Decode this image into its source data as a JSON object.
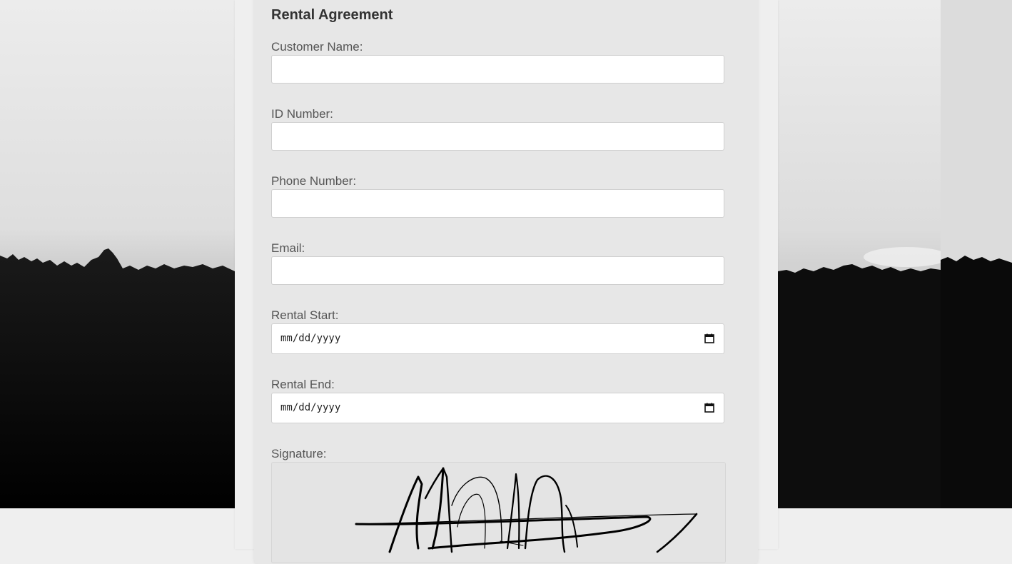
{
  "form": {
    "title": "Rental Agreement",
    "fields": [
      {
        "label": "Customer Name:",
        "value": ""
      },
      {
        "label": "ID Number:",
        "value": ""
      },
      {
        "label": "Phone Number:",
        "value": ""
      },
      {
        "label": "Email:",
        "value": ""
      },
      {
        "label": "Rental Start:",
        "placeholder": "mm/dd/yyyy"
      },
      {
        "label": "Rental End:",
        "placeholder": "mm/dd/yyyy"
      }
    ],
    "signature_label": "Signature:"
  },
  "icons": {
    "calendar": "calendar-icon"
  }
}
